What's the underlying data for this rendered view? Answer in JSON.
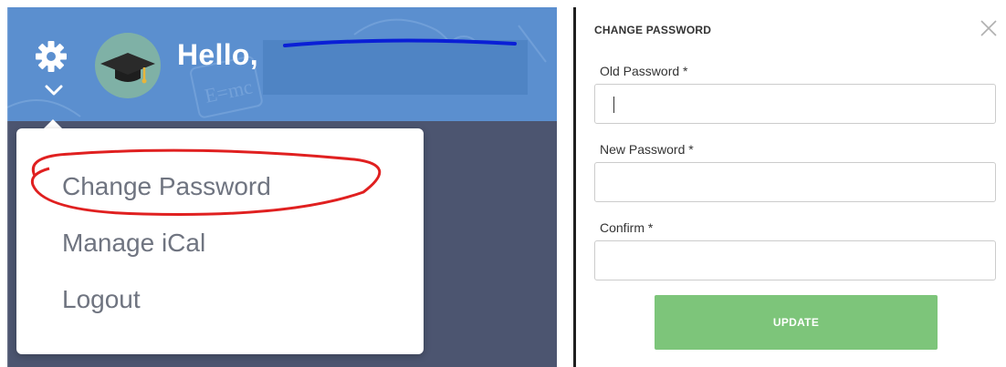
{
  "header": {
    "greeting": "Hello,",
    "settings_icon": "gear-icon",
    "dropdown_icon": "chevron-down-icon",
    "avatar_icon": "graduation-cap-icon"
  },
  "dropdown_menu": {
    "items": [
      {
        "label": "Change Password",
        "highlighted": true
      },
      {
        "label": "Manage iCal"
      },
      {
        "label": "Logout"
      }
    ]
  },
  "modal": {
    "title": "CHANGE PASSWORD",
    "close_icon": "close-icon",
    "fields": [
      {
        "label": "Old Password *",
        "value": ""
      },
      {
        "label": "New Password *",
        "value": ""
      },
      {
        "label": "Confirm *",
        "value": ""
      }
    ],
    "submit_label": "UPDATE"
  },
  "colors": {
    "header_blue": "#5b8fcf",
    "panel_slate": "#4c5570",
    "avatar_teal": "#7fb1a6",
    "highlight_red": "#e02020",
    "button_green": "#7dc57a"
  }
}
